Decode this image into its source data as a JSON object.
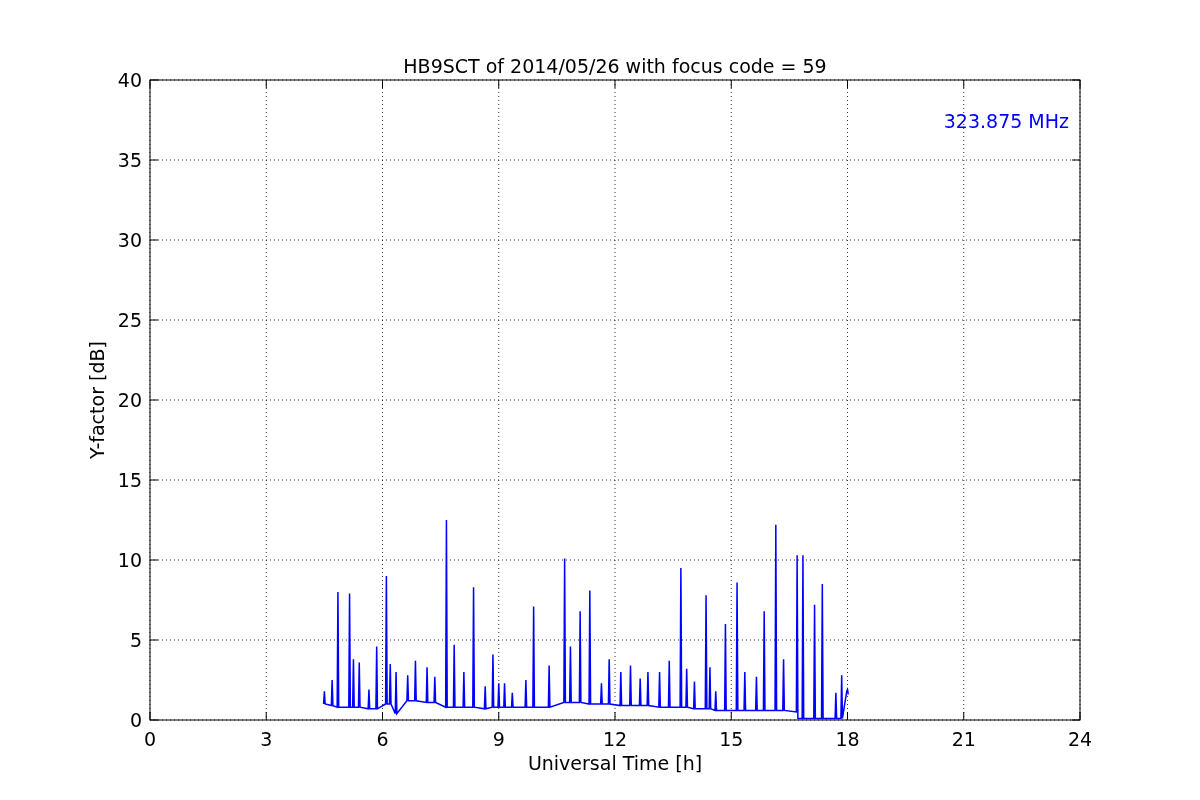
{
  "figure": {
    "chart_data": {
      "type": "line",
      "title": "HB9SCT of 2014/05/26 with focus code = 59",
      "xlabel": "Universal Time [h]",
      "ylabel": "Y-factor [dB]",
      "grid": true,
      "xlim": [
        0,
        24
      ],
      "ylim": [
        0,
        40
      ],
      "xticks": [
        0,
        3,
        6,
        9,
        12,
        15,
        18,
        21,
        24
      ],
      "yticks": [
        0,
        5,
        10,
        15,
        20,
        25,
        30,
        35,
        40
      ],
      "x": [
        4.48,
        4.5,
        4.52,
        4.68,
        4.7,
        4.72,
        4.83,
        4.85,
        4.87,
        5.13,
        5.15,
        5.17,
        5.23,
        5.25,
        5.27,
        5.38,
        5.4,
        5.42,
        5.63,
        5.65,
        5.67,
        5.83,
        5.85,
        5.87,
        6.08,
        6.1,
        6.12,
        6.18,
        6.2,
        6.22,
        6.33,
        6.35,
        6.37,
        6.63,
        6.65,
        6.67,
        6.83,
        6.85,
        6.87,
        7.13,
        7.15,
        7.17,
        7.33,
        7.35,
        7.37,
        7.63,
        7.65,
        7.67,
        7.83,
        7.85,
        7.87,
        8.08,
        8.1,
        8.12,
        8.33,
        8.35,
        8.37,
        8.63,
        8.65,
        8.67,
        8.83,
        8.85,
        8.87,
        8.98,
        9.0,
        9.02,
        9.13,
        9.15,
        9.17,
        9.33,
        9.35,
        9.37,
        9.68,
        9.7,
        9.72,
        9.88,
        9.9,
        9.92,
        10.28,
        10.3,
        10.32,
        10.68,
        10.7,
        10.72,
        10.83,
        10.85,
        10.87,
        11.08,
        11.1,
        11.12,
        11.33,
        11.35,
        11.37,
        11.63,
        11.65,
        11.67,
        11.83,
        11.85,
        11.87,
        12.13,
        12.15,
        12.17,
        12.38,
        12.4,
        12.42,
        12.63,
        12.65,
        12.67,
        12.83,
        12.85,
        12.87,
        13.13,
        13.15,
        13.17,
        13.38,
        13.4,
        13.42,
        13.68,
        13.7,
        13.72,
        13.83,
        13.85,
        13.87,
        14.03,
        14.05,
        14.07,
        14.33,
        14.35,
        14.37,
        14.43,
        14.45,
        14.47,
        14.58,
        14.6,
        14.62,
        14.83,
        14.85,
        14.87,
        15.13,
        15.15,
        15.17,
        15.33,
        15.35,
        15.37,
        15.63,
        15.65,
        15.67,
        15.83,
        15.85,
        15.87,
        16.13,
        16.15,
        16.17,
        16.33,
        16.35,
        16.37,
        16.68,
        16.7,
        16.72,
        16.83,
        16.85,
        16.87,
        17.13,
        17.15,
        17.17,
        17.33,
        17.35,
        17.37,
        17.68,
        17.7,
        17.72,
        17.83,
        17.85,
        17.87,
        17.98,
        18.0,
        18.02
      ],
      "series": [
        {
          "name": "323.875 MHz",
          "color": "#0000ff",
          "values": [
            1.0,
            1.8,
            1.0,
            0.9,
            2.5,
            0.9,
            0.8,
            8.0,
            0.8,
            0.8,
            7.9,
            0.8,
            0.8,
            3.8,
            0.8,
            0.8,
            3.6,
            0.8,
            0.7,
            1.9,
            0.7,
            0.7,
            4.6,
            0.7,
            1.0,
            9.0,
            1.0,
            1.0,
            3.5,
            1.0,
            0.4,
            3.0,
            0.4,
            1.2,
            2.8,
            1.2,
            1.2,
            3.7,
            1.2,
            1.1,
            3.3,
            1.1,
            1.1,
            2.7,
            1.1,
            0.8,
            12.5,
            0.8,
            0.8,
            4.7,
            0.8,
            0.8,
            3.0,
            0.8,
            0.8,
            8.3,
            0.8,
            0.7,
            2.1,
            0.7,
            0.8,
            4.1,
            0.8,
            0.8,
            2.3,
            0.8,
            0.8,
            2.3,
            0.8,
            0.8,
            1.7,
            0.8,
            0.8,
            2.5,
            0.8,
            0.8,
            7.1,
            0.8,
            0.8,
            3.4,
            0.8,
            1.1,
            10.1,
            1.1,
            1.1,
            4.6,
            1.1,
            1.1,
            6.8,
            1.1,
            1.0,
            8.1,
            1.0,
            1.0,
            2.3,
            1.0,
            1.0,
            3.8,
            1.0,
            0.9,
            3.0,
            0.9,
            0.9,
            3.4,
            0.9,
            0.9,
            2.6,
            0.9,
            0.9,
            3.0,
            0.9,
            0.8,
            3.0,
            0.8,
            0.8,
            3.7,
            0.8,
            0.8,
            9.5,
            0.8,
            0.8,
            3.2,
            0.8,
            0.7,
            2.4,
            0.7,
            0.7,
            7.8,
            0.7,
            0.7,
            3.3,
            0.7,
            0.6,
            1.8,
            0.6,
            0.6,
            6.0,
            0.6,
            0.6,
            8.6,
            0.6,
            0.6,
            3.0,
            0.6,
            0.6,
            2.7,
            0.6,
            0.6,
            6.8,
            0.6,
            0.6,
            12.2,
            0.6,
            0.6,
            3.8,
            0.6,
            0.5,
            10.3,
            0.1,
            0.1,
            10.3,
            0.1,
            0.1,
            7.2,
            0.1,
            0.1,
            8.5,
            0.1,
            0.1,
            1.7,
            0.1,
            0.1,
            2.8,
            0.1,
            1.8,
            1.9,
            1.6
          ]
        }
      ]
    }
  }
}
